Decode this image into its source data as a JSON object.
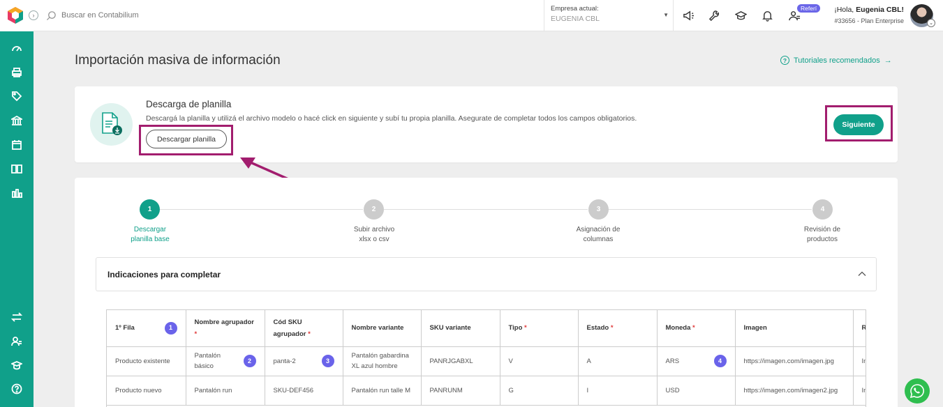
{
  "topbar": {
    "search_placeholder": "Buscar en Contabilium",
    "company_label": "Empresa actual:",
    "company_value": "EUGENIA CBL",
    "referi_badge": "Referí",
    "greeting_prefix": "¡Hola, ",
    "greeting_name": "Eugenia CBL",
    "greeting_suffix": "!",
    "plan": "#33656 - Plan Enterprise"
  },
  "page": {
    "title": "Importación masiva de información",
    "tutorials_link": "Tutoriales recomendados"
  },
  "download_card": {
    "title": "Descarga de planilla",
    "description": "Descargá la planilla y utilizá el archivo modelo o hacé click en siguiente y subí tu propia planilla. Asegurate de completar todos los campos obligatorios.",
    "download_button": "Descargar planilla",
    "next_button": "Siguiente"
  },
  "steps": [
    {
      "number": "1",
      "label": "Descargar\nplanilla base",
      "active": true
    },
    {
      "number": "2",
      "label": "Subir archivo\nxlsx o csv",
      "active": false
    },
    {
      "number": "3",
      "label": "Asignación de\ncolumnas",
      "active": false
    },
    {
      "number": "4",
      "label": "Revisión de\nproductos",
      "active": false
    }
  ],
  "accordion": {
    "title": "Indicaciones para completar"
  },
  "table": {
    "headers": [
      "1º Fila",
      "Nombre agrupador",
      "Cód SKU agrupador",
      "Nombre variante",
      "SKU variante",
      "Tipo",
      "Estado",
      "Moneda",
      "Imagen",
      "R"
    ],
    "required_mark": "*",
    "header_badge": "1",
    "rows": [
      [
        "Producto existente",
        "Pantalón básico",
        "panta-2",
        "Pantalón gabardina XL azul hombre",
        "PANRJGABXL",
        "V",
        "A",
        "ARS",
        "https://imagen.com/imagen.jpg",
        "In h"
      ],
      [
        "Producto nuevo",
        "Pantalón run",
        "SKU-DEF456",
        "Pantalón run talle M",
        "PANRUNM",
        "G",
        "I",
        "USD",
        "https://imagen.com/imagen2.jpg",
        "In n"
      ]
    ],
    "row_badges": [
      "2",
      "3",
      "4"
    ]
  },
  "colors": {
    "brand": "#10a08a",
    "highlight": "#a21d6e",
    "badge": "#6a63ea"
  },
  "icons": {
    "sidebar_top": [
      "dashboard-icon",
      "printer-icon",
      "tag-icon",
      "bank-icon",
      "calendar-icon",
      "book-icon",
      "bar-chart-icon"
    ],
    "sidebar_bottom": [
      "transfer-icon",
      "users-icon",
      "graduation-icon",
      "help-icon"
    ],
    "topbar": [
      "megaphone-icon",
      "wrench-icon",
      "graduation-cap-icon",
      "bell-icon",
      "refer-user-icon"
    ]
  }
}
